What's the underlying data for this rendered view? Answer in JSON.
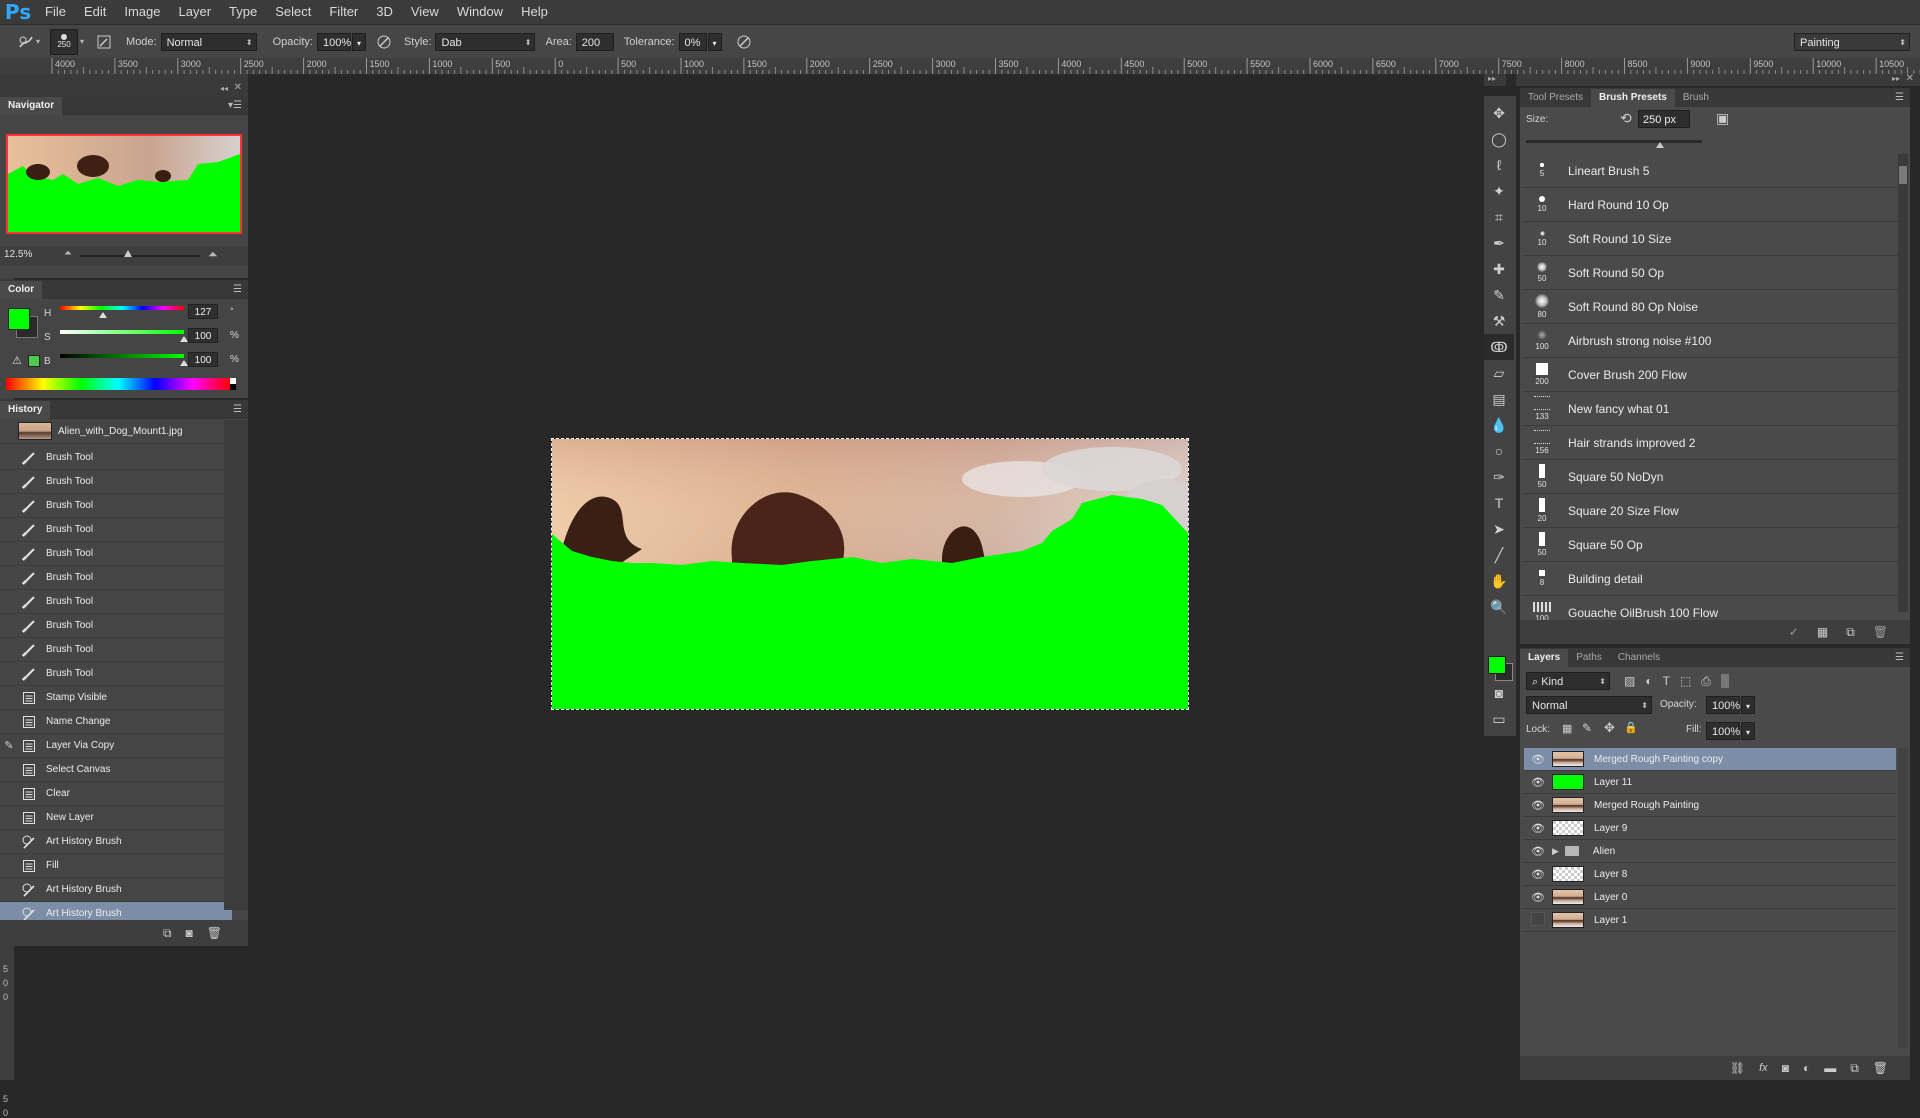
{
  "app": {
    "logo": "Ps",
    "menu": [
      "File",
      "Edit",
      "Image",
      "Layer",
      "Type",
      "Select",
      "Filter",
      "3D",
      "View",
      "Window",
      "Help"
    ]
  },
  "options": {
    "brush_size": "250",
    "mode_label": "Mode:",
    "mode_value": "Normal",
    "opacity_label": "Opacity:",
    "opacity_value": "100%",
    "style_label": "Style:",
    "style_value": "Dab",
    "area_label": "Area:",
    "area_value": "200 px",
    "tolerance_label": "Tolerance:",
    "tolerance_value": "0%",
    "workspace": "Painting"
  },
  "ruler": {
    "top_labels": [
      "4000",
      "3500",
      "3000",
      "2500",
      "2000",
      "1500",
      "1000",
      "500",
      "0",
      "500",
      "1000",
      "1500",
      "2000",
      "2500",
      "3000",
      "3500",
      "4000",
      "4500",
      "5000",
      "5500",
      "6000",
      "6500",
      "7000",
      "7500",
      "8000",
      "8500",
      "9000",
      "9500",
      "10000",
      "10500"
    ],
    "left_labels": [
      "0",
      "5",
      "0",
      "0",
      "5",
      "0"
    ]
  },
  "navigator": {
    "title": "Navigator",
    "zoom": "12.5%"
  },
  "color": {
    "title": "Color",
    "foreground": "#00ff00",
    "h_label": "H",
    "h_value": "127",
    "h_unit": "°",
    "s_label": "S",
    "s_value": "100",
    "s_unit": "%",
    "b_label": "B",
    "b_value": "100",
    "b_unit": "%"
  },
  "history": {
    "title": "History",
    "snapshot": "Alien_with_Dog_Mount1.jpg",
    "items": [
      {
        "label": "Brush Tool",
        "icon": "brush-icon"
      },
      {
        "label": "Brush Tool",
        "icon": "brush-icon"
      },
      {
        "label": "Brush Tool",
        "icon": "brush-icon"
      },
      {
        "label": "Brush Tool",
        "icon": "brush-icon"
      },
      {
        "label": "Brush Tool",
        "icon": "brush-icon"
      },
      {
        "label": "Brush Tool",
        "icon": "brush-icon"
      },
      {
        "label": "Brush Tool",
        "icon": "brush-icon"
      },
      {
        "label": "Brush Tool",
        "icon": "brush-icon"
      },
      {
        "label": "Brush Tool",
        "icon": "brush-icon"
      },
      {
        "label": "Brush Tool",
        "icon": "brush-icon"
      },
      {
        "label": "Stamp Visible",
        "icon": "document-icon"
      },
      {
        "label": "Name Change",
        "icon": "document-icon"
      },
      {
        "label": "Layer Via Copy",
        "icon": "document-icon"
      },
      {
        "label": "Select Canvas",
        "icon": "document-icon"
      },
      {
        "label": "Clear",
        "icon": "document-icon"
      },
      {
        "label": "New Layer",
        "icon": "document-icon"
      },
      {
        "label": "Art History Brush",
        "icon": "art-history-brush-icon"
      },
      {
        "label": "Fill",
        "icon": "document-icon"
      },
      {
        "label": "Art History Brush",
        "icon": "art-history-brush-icon"
      },
      {
        "label": "Art History Brush",
        "icon": "art-history-brush-icon"
      }
    ]
  },
  "brush_panel": {
    "tabs": [
      "Tool Presets",
      "Brush Presets",
      "Brush"
    ],
    "size_label": "Size:",
    "size_value": "250 px",
    "presets": [
      {
        "name": "Lineart Brush 5",
        "size": "5"
      },
      {
        "name": "Hard Round 10 Op",
        "size": "10"
      },
      {
        "name": "Soft Round 10 Size",
        "size": "10"
      },
      {
        "name": "Soft Round 50 Op",
        "size": "50"
      },
      {
        "name": "Soft Round 80 Op Noise",
        "size": "80"
      },
      {
        "name": "Airbrush strong noise #100",
        "size": "100"
      },
      {
        "name": "Cover Brush 200 Flow",
        "size": "200"
      },
      {
        "name": "New fancy what 01",
        "size": "133"
      },
      {
        "name": "Hair strands improved 2",
        "size": "156"
      },
      {
        "name": "Square 50 NoDyn",
        "size": "50"
      },
      {
        "name": "Square 20 Size Flow",
        "size": "20"
      },
      {
        "name": "Square 50 Op",
        "size": "50"
      },
      {
        "name": "Building detail",
        "size": "8"
      },
      {
        "name": "Gouache OilBrush 100 Flow",
        "size": "100"
      }
    ]
  },
  "layers_panel": {
    "tabs": [
      "Layers",
      "Paths",
      "Channels"
    ],
    "filter": "Kind",
    "blend_mode": "Normal",
    "opacity_label": "Opacity:",
    "opacity_value": "100%",
    "lock_label": "Lock:",
    "fill_label": "Fill:",
    "fill_value": "100%",
    "layers": [
      {
        "name": "Merged Rough Painting copy",
        "visible": true,
        "thumb": "painting"
      },
      {
        "name": "Layer 11",
        "visible": true,
        "thumb": "green"
      },
      {
        "name": "Merged Rough Painting",
        "visible": true,
        "thumb": "painting"
      },
      {
        "name": "Layer 9",
        "visible": true,
        "thumb": "transparent"
      },
      {
        "name": "Alien",
        "visible": true,
        "thumb": "folder"
      },
      {
        "name": "Layer 8",
        "visible": true,
        "thumb": "transparent"
      },
      {
        "name": "Layer 0",
        "visible": true,
        "thumb": "painting"
      },
      {
        "name": "Layer 1",
        "visible": false,
        "thumb": "painting"
      }
    ]
  }
}
